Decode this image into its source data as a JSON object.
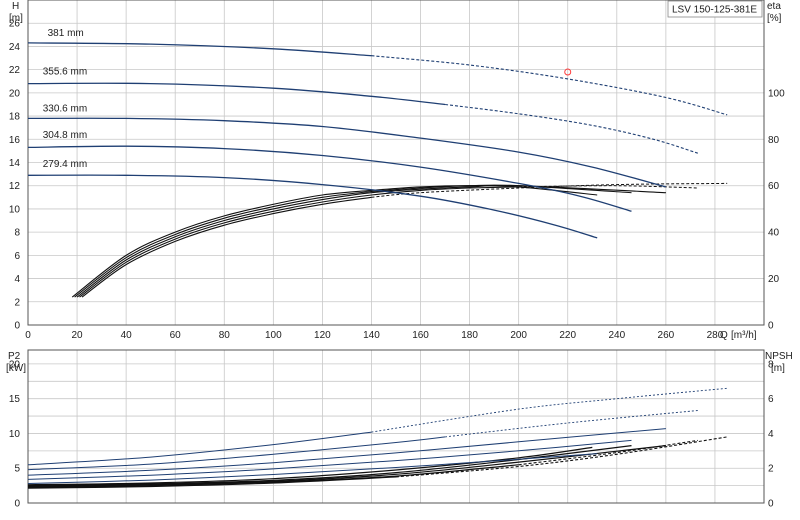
{
  "title": "LSV 150-125-381E",
  "colors": {
    "curve": "#1f3f73",
    "grid": "#c8c8c8",
    "axis": "#555555",
    "marker": "#ff3b3b",
    "eta": "#111111"
  },
  "chart_data": [
    {
      "type": "line",
      "name": "head",
      "title": "LSV 150-125-381E",
      "ylabel": "H",
      "yunit": "[m]",
      "ylabel_right": "eta",
      "yunit_right": "[%]",
      "xlabel": "Q",
      "xunit": "[m³/h]",
      "xlim": [
        0,
        300
      ],
      "ylim": [
        0,
        28
      ],
      "ylim_right": [
        0,
        140
      ],
      "x_ticks": [
        0,
        20,
        40,
        60,
        80,
        100,
        120,
        140,
        160,
        180,
        200,
        220,
        240,
        260,
        280
      ],
      "y_ticks": [
        0,
        2,
        4,
        6,
        8,
        10,
        12,
        14,
        16,
        18,
        20,
        22,
        24,
        26
      ],
      "y_right_ticks": [
        0,
        20,
        40,
        60,
        80,
        100
      ],
      "grid": true,
      "series": [
        {
          "name": "381 mm",
          "label_x": 8,
          "label_y": 24.9,
          "solid": [
            [
              0,
              24.3
            ],
            [
              50,
              24.2
            ],
            [
              100,
              23.8
            ],
            [
              140,
              23.2
            ]
          ],
          "dashed": [
            [
              140,
              23.2
            ],
            [
              180,
              22.4
            ],
            [
              220,
              21.2
            ],
            [
              260,
              19.6
            ],
            [
              285,
              18.1
            ]
          ]
        },
        {
          "name": "355.6 mm",
          "label_x": 6,
          "label_y": 21.6,
          "solid": [
            [
              0,
              20.8
            ],
            [
              50,
              20.8
            ],
            [
              100,
              20.4
            ],
            [
              140,
              19.7
            ],
            [
              170,
              19.0
            ]
          ],
          "dashed": [
            [
              170,
              19.0
            ],
            [
              200,
              18.2
            ],
            [
              230,
              17.2
            ],
            [
              255,
              16.0
            ],
            [
              273,
              14.8
            ]
          ]
        },
        {
          "name": "330.6 mm",
          "label_x": 6,
          "label_y": 18.4,
          "solid": [
            [
              0,
              17.8
            ],
            [
              40,
              17.8
            ],
            [
              80,
              17.6
            ],
            [
              120,
              17.1
            ],
            [
              160,
              16.1
            ],
            [
              200,
              14.9
            ],
            [
              230,
              13.6
            ],
            [
              260,
              11.9
            ]
          ],
          "dashed": []
        },
        {
          "name": "304.8 mm",
          "label_x": 6,
          "label_y": 16.1,
          "solid": [
            [
              0,
              15.3
            ],
            [
              40,
              15.4
            ],
            [
              80,
              15.2
            ],
            [
              120,
              14.6
            ],
            [
              160,
              13.6
            ],
            [
              200,
              12.2
            ],
            [
              225,
              11.1
            ],
            [
              246,
              9.8
            ]
          ],
          "dashed": []
        },
        {
          "name": "279.4 mm",
          "label_x": 6,
          "label_y": 13.6,
          "solid": [
            [
              0,
              12.9
            ],
            [
              40,
              12.9
            ],
            [
              80,
              12.7
            ],
            [
              120,
              12.1
            ],
            [
              160,
              11.1
            ],
            [
              190,
              9.9
            ],
            [
              215,
              8.6
            ],
            [
              232,
              7.5
            ]
          ],
          "dashed": []
        }
      ],
      "efficiency": [
        {
          "solid": [
            [
              18,
              12
            ],
            [
              40,
              30
            ],
            [
              60,
              40
            ],
            [
              80,
              47
            ],
            [
              100,
              52
            ],
            [
              120,
              56
            ],
            [
              140,
              58
            ],
            [
              160,
              59.5
            ],
            [
              180,
              60
            ],
            [
              200,
              59.5
            ],
            [
              232,
              56
            ]
          ],
          "dashed": []
        },
        {
          "solid": [
            [
              19,
              12
            ],
            [
              40,
              29
            ],
            [
              60,
              39
            ],
            [
              80,
              46
            ],
            [
              100,
              51
            ],
            [
              120,
              55
            ],
            [
              140,
              57.5
            ],
            [
              160,
              59
            ],
            [
              180,
              60
            ],
            [
              200,
              60
            ],
            [
              246,
              57
            ]
          ],
          "dashed": []
        },
        {
          "solid": [
            [
              20,
              12
            ],
            [
              40,
              28
            ],
            [
              60,
              38
            ],
            [
              80,
              45
            ],
            [
              100,
              50
            ],
            [
              120,
              54
            ],
            [
              140,
              57
            ],
            [
              160,
              58.5
            ],
            [
              180,
              59.5
            ],
            [
              200,
              60
            ],
            [
              260,
              57
            ]
          ],
          "dashed": []
        },
        {
          "solid": [
            [
              21,
              12
            ],
            [
              40,
              27
            ],
            [
              60,
              37
            ],
            [
              80,
              44
            ],
            [
              100,
              49
            ],
            [
              120,
              53
            ],
            [
              140,
              56
            ],
            [
              160,
              58
            ],
            [
              180,
              59
            ],
            [
              200,
              59.5
            ]
          ],
          "dashed": [
            [
              200,
              59.5
            ],
            [
              240,
              60
            ],
            [
              273,
              59
            ]
          ]
        },
        {
          "solid": [
            [
              22,
              12
            ],
            [
              40,
              26
            ],
            [
              60,
              36
            ],
            [
              80,
              43
            ],
            [
              100,
              48
            ],
            [
              120,
              52
            ],
            [
              140,
              55
            ]
          ],
          "dashed": [
            [
              140,
              55
            ],
            [
              160,
              57
            ],
            [
              200,
              59
            ],
            [
              240,
              60.5
            ],
            [
              285,
              61
            ]
          ]
        }
      ],
      "operating_point": {
        "x": 220,
        "y": 21.8
      }
    },
    {
      "type": "line",
      "name": "power-npsh",
      "ylabel": "P2",
      "yunit": "[kW]",
      "ylabel_right": "NPSH",
      "yunit_right": "[m]",
      "xlim": [
        0,
        300
      ],
      "ylim": [
        0,
        22
      ],
      "ylim_right": [
        0,
        8.8
      ],
      "y_ticks": [
        0,
        5,
        10,
        15,
        20
      ],
      "y_right_ticks": [
        0,
        2,
        4,
        6,
        8
      ],
      "grid": true,
      "power": [
        {
          "solid": [
            [
              0,
              5.5
            ],
            [
              50,
              6.6
            ],
            [
              100,
              8.4
            ],
            [
              140,
              10.2
            ]
          ],
          "dashed": [
            [
              140,
              10.2
            ],
            [
              200,
              13.5
            ],
            [
              240,
              15.0
            ],
            [
              285,
              16.5
            ]
          ]
        },
        {
          "solid": [
            [
              0,
              4.8
            ],
            [
              50,
              5.6
            ],
            [
              100,
              7.0
            ],
            [
              150,
              8.7
            ],
            [
              170,
              9.5
            ]
          ],
          "dashed": [
            [
              170,
              9.5
            ],
            [
              220,
              11.5
            ],
            [
              273,
              13.3
            ]
          ]
        },
        {
          "solid": [
            [
              0,
              4.0
            ],
            [
              50,
              4.7
            ],
            [
              100,
              5.8
            ],
            [
              150,
              7.2
            ],
            [
              200,
              8.8
            ],
            [
              260,
              10.7
            ]
          ],
          "dashed": []
        },
        {
          "solid": [
            [
              0,
              3.4
            ],
            [
              50,
              4.0
            ],
            [
              100,
              4.9
            ],
            [
              150,
              6.1
            ],
            [
              200,
              7.5
            ],
            [
              246,
              9.0
            ]
          ],
          "dashed": []
        },
        {
          "solid": [
            [
              0,
              2.8
            ],
            [
              50,
              3.3
            ],
            [
              100,
              4.1
            ],
            [
              150,
              5.1
            ],
            [
              200,
              6.3
            ],
            [
              232,
              7.1
            ]
          ],
          "dashed": []
        }
      ],
      "npsh": [
        {
          "solid": [
            [
              0,
              1.05
            ],
            [
              50,
              1.15
            ],
            [
              100,
              1.4
            ],
            [
              150,
              1.9
            ],
            [
              200,
              2.6
            ],
            [
              230,
              3.2
            ]
          ],
          "dashed": []
        },
        {
          "solid": [
            [
              0,
              1.0
            ],
            [
              50,
              1.1
            ],
            [
              100,
              1.3
            ],
            [
              150,
              1.75
            ],
            [
              200,
              2.5
            ],
            [
              246,
              3.3
            ]
          ],
          "dashed": []
        },
        {
          "solid": [
            [
              0,
              0.95
            ],
            [
              50,
              1.05
            ],
            [
              100,
              1.25
            ],
            [
              150,
              1.65
            ],
            [
              200,
              2.35
            ],
            [
              260,
              3.3
            ]
          ],
          "dashed": []
        },
        {
          "solid": [
            [
              0,
              0.9
            ],
            [
              50,
              1.0
            ],
            [
              100,
              1.2
            ],
            [
              150,
              1.55
            ],
            [
              200,
              2.2
            ]
          ],
          "dashed": [
            [
              200,
              2.2
            ],
            [
              240,
              2.9
            ],
            [
              273,
              3.6
            ]
          ]
        },
        {
          "solid": [
            [
              0,
              0.85
            ],
            [
              50,
              0.95
            ],
            [
              100,
              1.15
            ],
            [
              150,
              1.5
            ]
          ],
          "dashed": [
            [
              150,
              1.5
            ],
            [
              200,
              2.1
            ],
            [
              240,
              2.8
            ],
            [
              285,
              3.8
            ]
          ]
        }
      ]
    }
  ]
}
